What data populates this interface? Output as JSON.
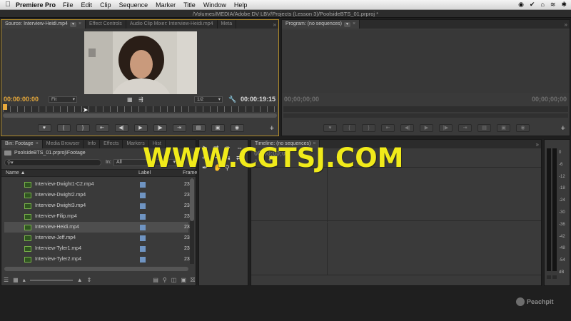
{
  "menubar": {
    "app_name": "Premiere Pro",
    "items": [
      "File",
      "Edit",
      "Clip",
      "Sequence",
      "Marker",
      "Title",
      "Window",
      "Help"
    ]
  },
  "window": {
    "title": "/Volumes/MEDIA/Adobe DV LBV/Projects (Lesson 3)/PoolsideBTS_01.prproj *"
  },
  "source_panel": {
    "tabs": [
      "Source: Interview-Heidi.mp4",
      "Effect Controls",
      "Audio Clip Mixer: Interview-Heidi.mp4",
      "Meta"
    ],
    "timecode_in": "00:00:00:00",
    "fit_option": "Fit",
    "resolution": "1/2",
    "timecode_duration": "00:00:19:15"
  },
  "program_panel": {
    "tab": "Program: (no sequences)",
    "timecode_in": "00;00;00;00",
    "timecode_out": "00;00;00;00"
  },
  "bin_panel": {
    "tabs": [
      "Bin: Footage",
      "Media Browser",
      "Info",
      "Effects",
      "Markers",
      "Hist"
    ],
    "path": "PoolsideBTS_01.prproj\\Footage",
    "search_in_label": "In:",
    "search_in_value": "All",
    "columns": [
      "Name",
      "Label",
      "Frame"
    ],
    "items": [
      {
        "name": "Interview-Dwight1-C2.mp4",
        "frames": "23"
      },
      {
        "name": "Interview-Dwight2.mp4",
        "frames": "23"
      },
      {
        "name": "Interview-Dwight3.mp4",
        "frames": "23"
      },
      {
        "name": "Interview-Filip.mp4",
        "frames": "23"
      },
      {
        "name": "Interview-Heidi.mp4",
        "frames": "23",
        "selected": true
      },
      {
        "name": "Interview-Jeff.mp4",
        "frames": "23"
      },
      {
        "name": "Interview-Tyler1.mp4",
        "frames": "23"
      },
      {
        "name": "Interview-Tyler2.mp4",
        "frames": "23"
      }
    ]
  },
  "timeline_panel": {
    "tab": "Timeline: (no sequences)",
    "timecode": "00;00;00;00"
  },
  "meters": {
    "scale": [
      "0",
      "-6",
      "-12",
      "-18",
      "-24",
      "-30",
      "-36",
      "-42",
      "-48",
      "-54",
      "dB"
    ]
  },
  "watermark": "WWW.CGTSJ.COM",
  "brand": "Peachpit",
  "colors": {
    "accent": "#e7a93b",
    "watermark": "#f0ea1a",
    "label_blue": "#6f94c2",
    "clip_green": "#79b04a"
  }
}
